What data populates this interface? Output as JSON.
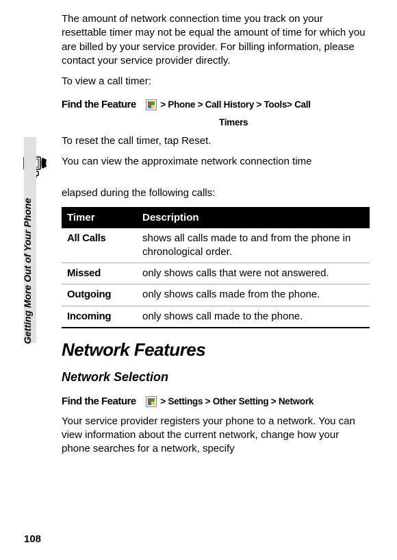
{
  "page_number": "108",
  "sidebar_label": "Getting More Out of Your Phone",
  "paragraphs": {
    "p1": "The amount of network connection time you track on your resettable timer may not be equal the amount of time for which you are billed by your service provider. For billing information, please contact your service provider directly.",
    "p2": "To view a call timer:",
    "p3": "To reset the call timer, tap Reset.",
    "p4": "You can view the approximate network connection time",
    "p5": "elapsed during the following calls:",
    "p6": "Your service provider registers your phone to a network. You can view information about the current network, change how your phone searches for a network, specify"
  },
  "feature_label": "Find the Feature",
  "paths": {
    "timer0": " > ",
    "timer1": "Phone",
    "timer2": " > ",
    "timer3": "Call History",
    "timer4": " > ",
    "timer5": "Tools",
    "timer6": "> ",
    "timer7": "Call",
    "timer_cont": "Timers",
    "net0": " > ",
    "net1": "Settings",
    "net2": " > ",
    "net3": "Other Setting",
    "net4": " > ",
    "net5": "Network"
  },
  "table": {
    "h1": "Timer",
    "h2": "Description",
    "rows": [
      {
        "label": "All Calls",
        "desc": "shows all calls made to and from the phone in chronological order."
      },
      {
        "label": "Missed",
        "desc": "only shows calls that were not answered."
      },
      {
        "label": "Outgoing",
        "desc": "only shows calls made from the phone."
      },
      {
        "label": "Incoming",
        "desc": "only shows call made to the phone."
      }
    ]
  },
  "headings": {
    "h2": "Network Features",
    "h3": "Network Selection"
  }
}
